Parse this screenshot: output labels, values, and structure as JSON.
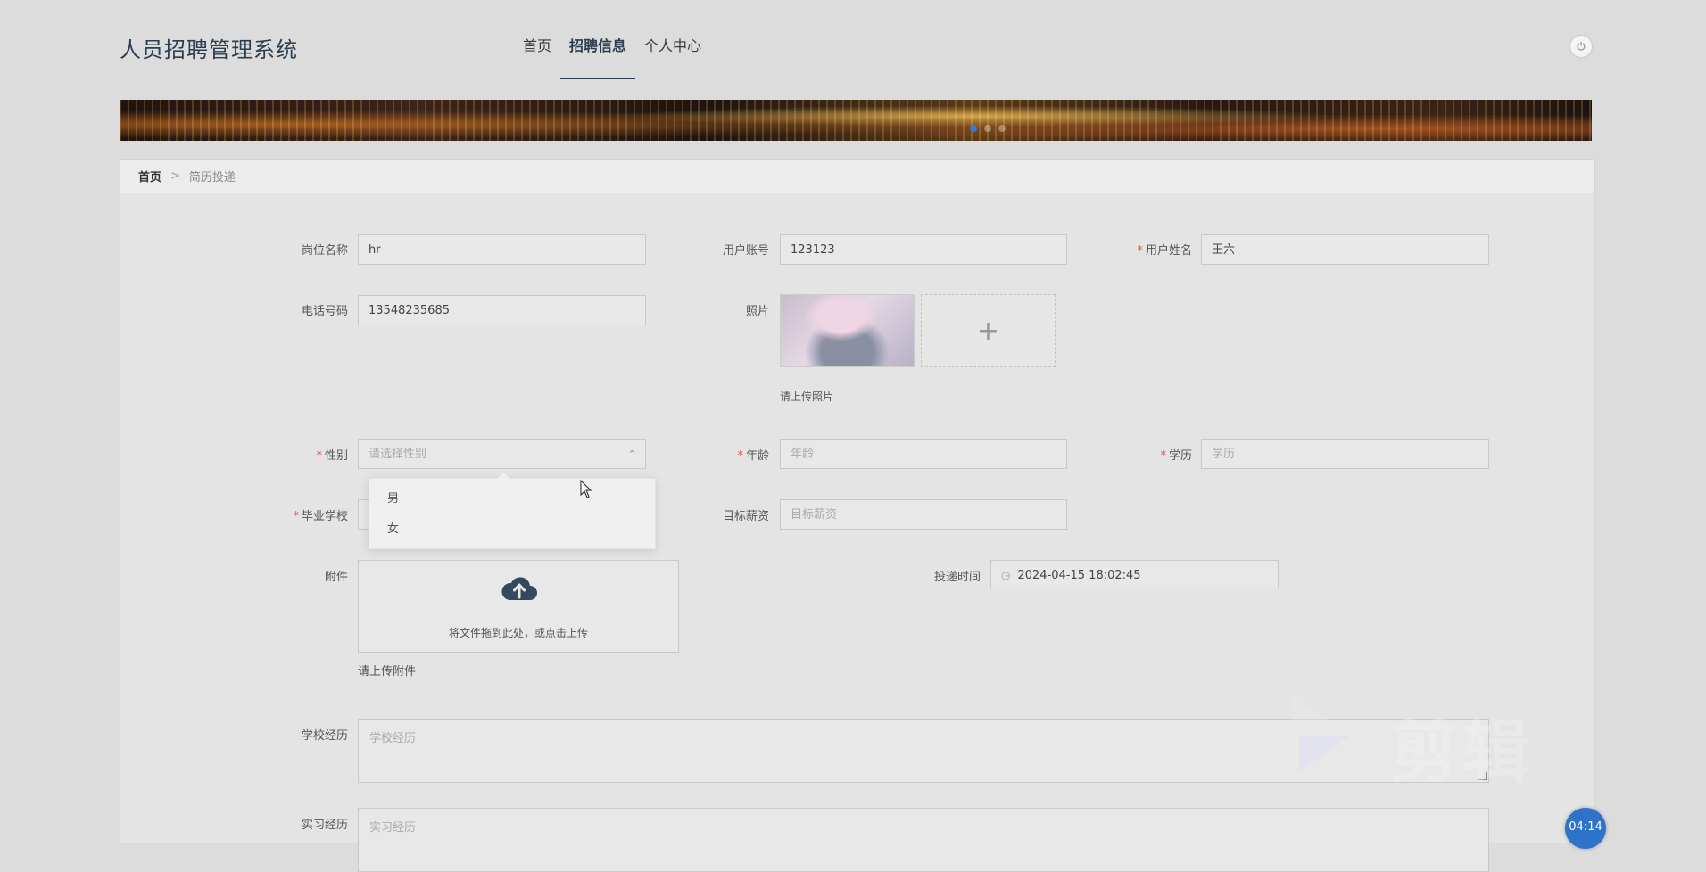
{
  "header": {
    "logo": "人员招聘管理系统",
    "nav": [
      "首页",
      "招聘信息",
      "个人中心"
    ],
    "active_nav": "招聘信息"
  },
  "breadcrumb": {
    "home": "首页",
    "sep": ">",
    "current": "简历投递"
  },
  "form": {
    "position_label": "岗位名称",
    "position_value": "hr",
    "account_label": "用户账号",
    "account_value": "123123",
    "realname_label": "用户姓名",
    "realname_value": "王六",
    "phone_label": "电话号码",
    "phone_value": "13548235685",
    "photo_label": "照片",
    "photo_hint": "请上传照片",
    "photo_add": "+",
    "gender_label": "性别",
    "gender_placeholder": "请选择性别",
    "gender_options": [
      "男",
      "女"
    ],
    "age_label": "年龄",
    "age_placeholder": "年龄",
    "education_label": "学历",
    "education_placeholder": "学历",
    "school_label": "毕业学校",
    "salary_label": "目标薪资",
    "salary_placeholder": "目标薪资",
    "attachment_label": "附件",
    "upload_text": "将文件拖到此处，或点击上传",
    "attachment_hint": "请上传附件",
    "submit_time_label": "投递时间",
    "submit_time_value": "2024-04-15 18:02:45",
    "school_exp_label": "学校经历",
    "school_exp_placeholder": "学校经历",
    "intern_exp_label": "实习经历",
    "intern_exp_placeholder": "实习经历",
    "required_mark": "*"
  },
  "overlay": {
    "watermark": "剪辑",
    "timer": "04:14"
  },
  "colors": {
    "accent": "#2c3e50",
    "required": "#e74c3c",
    "timer": "#2f72c9"
  }
}
